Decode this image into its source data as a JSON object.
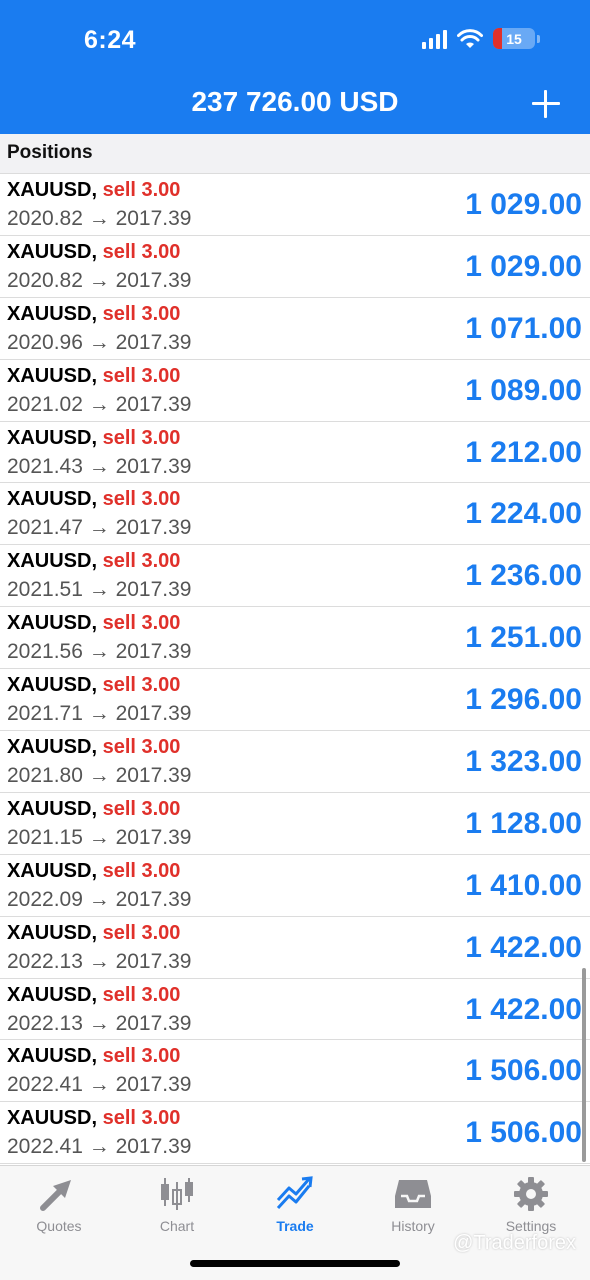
{
  "status_bar": {
    "time": "6:24",
    "battery": "15"
  },
  "header": {
    "balance": "237 726.00 USD"
  },
  "section": {
    "title": "Positions"
  },
  "positions": [
    {
      "symbol": "XAUUSD,",
      "side": "sell 3.00",
      "prices": "2020.82 → 2017.39",
      "profit": "1 029.00"
    },
    {
      "symbol": "XAUUSD,",
      "side": "sell 3.00",
      "prices": "2020.82 → 2017.39",
      "profit": "1 029.00"
    },
    {
      "symbol": "XAUUSD,",
      "side": "sell 3.00",
      "prices": "2020.96 → 2017.39",
      "profit": "1 071.00"
    },
    {
      "symbol": "XAUUSD,",
      "side": "sell 3.00",
      "prices": "2021.02 → 2017.39",
      "profit": "1 089.00"
    },
    {
      "symbol": "XAUUSD,",
      "side": "sell 3.00",
      "prices": "2021.43 → 2017.39",
      "profit": "1 212.00"
    },
    {
      "symbol": "XAUUSD,",
      "side": "sell 3.00",
      "prices": "2021.47 → 2017.39",
      "profit": "1 224.00"
    },
    {
      "symbol": "XAUUSD,",
      "side": "sell 3.00",
      "prices": "2021.51 → 2017.39",
      "profit": "1 236.00"
    },
    {
      "symbol": "XAUUSD,",
      "side": "sell 3.00",
      "prices": "2021.56 → 2017.39",
      "profit": "1 251.00"
    },
    {
      "symbol": "XAUUSD,",
      "side": "sell 3.00",
      "prices": "2021.71 → 2017.39",
      "profit": "1 296.00"
    },
    {
      "symbol": "XAUUSD,",
      "side": "sell 3.00",
      "prices": "2021.80 → 2017.39",
      "profit": "1 323.00"
    },
    {
      "symbol": "XAUUSD,",
      "side": "sell 3.00",
      "prices": "2021.15 → 2017.39",
      "profit": "1 128.00"
    },
    {
      "symbol": "XAUUSD,",
      "side": "sell 3.00",
      "prices": "2022.09 → 2017.39",
      "profit": "1 410.00"
    },
    {
      "symbol": "XAUUSD,",
      "side": "sell 3.00",
      "prices": "2022.13 → 2017.39",
      "profit": "1 422.00"
    },
    {
      "symbol": "XAUUSD,",
      "side": "sell 3.00",
      "prices": "2022.13 → 2017.39",
      "profit": "1 422.00"
    },
    {
      "symbol": "XAUUSD,",
      "side": "sell 3.00",
      "prices": "2022.41 → 2017.39",
      "profit": "1 506.00"
    },
    {
      "symbol": "XAUUSD,",
      "side": "sell 3.00",
      "prices": "2022.41 → 2017.39",
      "profit": "1 506.00"
    }
  ],
  "tabs": [
    {
      "label": "Quotes",
      "icon": "quotes-icon"
    },
    {
      "label": "Chart",
      "icon": "candlestick-chart-icon"
    },
    {
      "label": "Trade",
      "icon": "trade-icon",
      "active": true
    },
    {
      "label": "History",
      "icon": "inbox-tray-icon"
    },
    {
      "label": "Settings",
      "icon": "gear-icon"
    }
  ],
  "watermark": "@Traderforex",
  "colors": {
    "accent": "#1a7cf0",
    "sell": "#e0302a",
    "profit": "#1a7cf0"
  }
}
